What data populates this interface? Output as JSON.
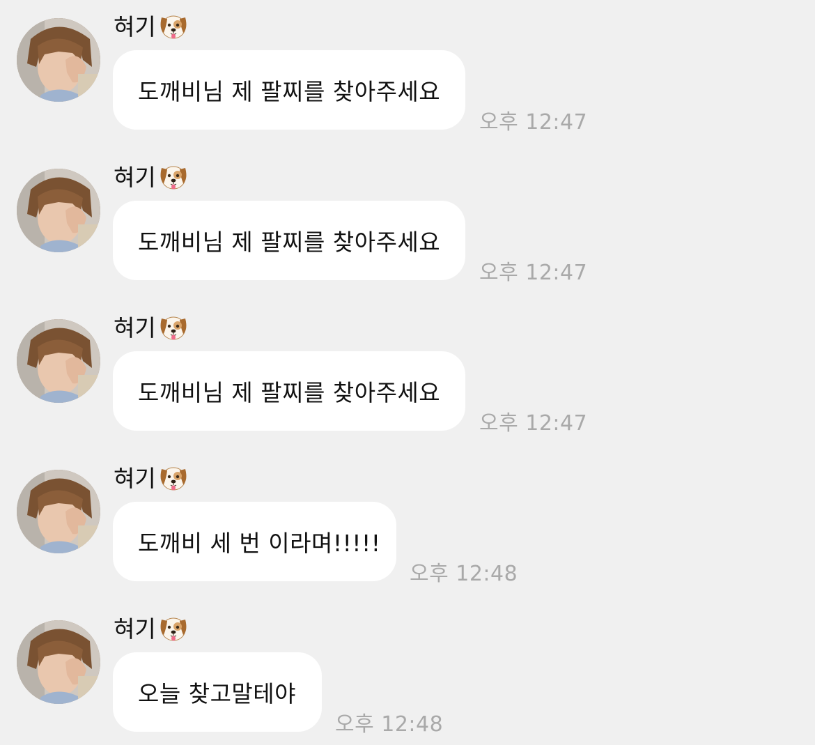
{
  "messages": [
    {
      "sender": "혀기",
      "sender_emoji": "dog-face-icon",
      "text": "도깨비님 제 팔찌를 찾아주세요",
      "time": "오후 12:47"
    },
    {
      "sender": "혀기",
      "sender_emoji": "dog-face-icon",
      "text": "도깨비님 제 팔찌를 찾아주세요",
      "time": "오후 12:47"
    },
    {
      "sender": "혀기",
      "sender_emoji": "dog-face-icon",
      "text": "도깨비님 제 팔찌를 찾아주세요",
      "time": "오후 12:47"
    },
    {
      "sender": "혀기",
      "sender_emoji": "dog-face-icon",
      "text": "도깨비 세 번 이라며!!!!!",
      "time": "오후 12:48"
    },
    {
      "sender": "혀기",
      "sender_emoji": "dog-face-icon",
      "text": "오늘 찾고말테야",
      "time": "오후 12:48"
    }
  ],
  "colors": {
    "background": "#f0f0f0",
    "bubble": "#ffffff",
    "timestamp": "#a9a9a9",
    "text": "#111111"
  }
}
